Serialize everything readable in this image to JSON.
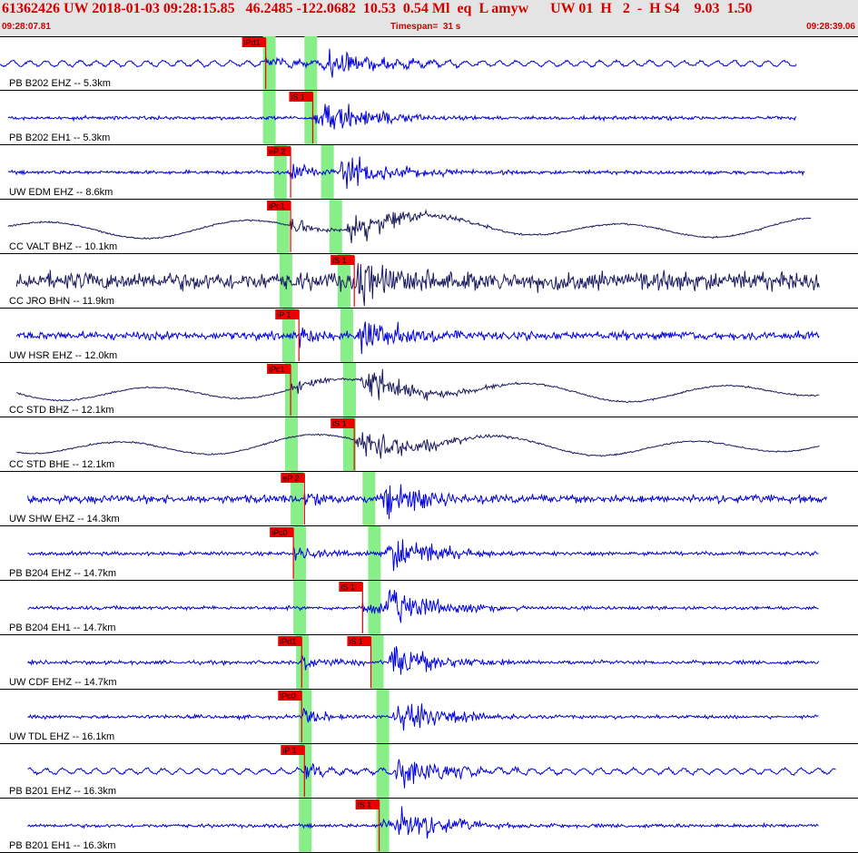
{
  "header": {
    "title": "61362426 UW 2018-01-03 09:28:15.85   46.2485 -122.0682  10.53  0.54 Ml  eq  L amyw      UW 01  H   2  -  H S4    9.03  1.50",
    "start_time": "09:28:07.81",
    "timespan": "Timespan=  31 s",
    "end_time": "09:28:39.06"
  },
  "colors": {
    "blue_trace": "#0000dd",
    "dark_trace": "#1a1a5e",
    "pick": "#ee0000",
    "window": "#88ee88",
    "header_text": "#d40000"
  },
  "chart_data": {
    "type": "seismogram",
    "x_range": [
      0,
      31
    ],
    "x_unit": "s",
    "traces": [
      {
        "label": "PB B202 EHZ -- 5.3km",
        "color": "blue",
        "trace_start": 0.0,
        "trace_end": 28.8,
        "picks": [
          {
            "text": "iPd1",
            "t": 9.6
          }
        ],
        "windows": [
          9.5,
          11.0
        ],
        "style": "microseism"
      },
      {
        "label": "PB B202 EH1 -- 5.3km",
        "color": "blue",
        "trace_start": 0.3,
        "trace_end": 28.8,
        "picks": [
          {
            "text": "iS 1",
            "t": 11.3
          }
        ],
        "windows": [
          9.5,
          11.0
        ],
        "style": "quiet"
      },
      {
        "label": "UW EDM EHZ -- 8.6km",
        "color": "blue",
        "trace_start": 0.3,
        "trace_end": 29.1,
        "picks": [
          {
            "text": "eP 2",
            "t": 10.5
          }
        ],
        "windows": [
          9.9,
          11.6
        ],
        "style": "quiet"
      },
      {
        "label": "CC VALT BHZ -- 10.1km",
        "color": "dark",
        "trace_start": 0.3,
        "trace_end": 29.3,
        "picks": [
          {
            "text": "iPc1",
            "t": 10.5
          }
        ],
        "windows": [
          10.0,
          11.9
        ],
        "style": "longperiod"
      },
      {
        "label": "CC JRO BHN -- 11.9km",
        "color": "dark",
        "trace_start": 0.6,
        "trace_end": 29.6,
        "picks": [
          {
            "text": "iS 1",
            "t": 12.8
          }
        ],
        "windows": [
          10.1,
          12.2
        ],
        "style": "noisy"
      },
      {
        "label": "UW HSR EHZ -- 12.0km",
        "color": "blue",
        "trace_start": 0.6,
        "trace_end": 29.6,
        "picks": [
          {
            "text": "iP 1",
            "t": 10.8
          }
        ],
        "windows": [
          10.2,
          12.3
        ],
        "style": "moderate"
      },
      {
        "label": "CC STD BHZ -- 12.1km",
        "color": "dark",
        "trace_start": 0.6,
        "trace_end": 29.6,
        "picks": [
          {
            "text": "iPc1",
            "t": 10.5
          }
        ],
        "windows": [
          10.3,
          12.4
        ],
        "style": "longperiod"
      },
      {
        "label": "CC STD BHE -- 12.1km",
        "color": "dark",
        "trace_start": 0.6,
        "trace_end": 29.6,
        "picks": [
          {
            "text": "iS 1",
            "t": 12.8
          }
        ],
        "windows": [
          10.3,
          12.4
        ],
        "style": "longperiod"
      },
      {
        "label": "UW SHW EHZ -- 14.3km",
        "color": "blue",
        "trace_start": 1.0,
        "trace_end": 29.9,
        "picks": [
          {
            "text": "eP 2",
            "t": 11.0
          }
        ],
        "windows": [
          10.5,
          13.1
        ],
        "style": "moderate"
      },
      {
        "label": "PB B204 EHZ -- 14.7km",
        "color": "blue",
        "trace_start": 1.0,
        "trace_end": 29.6,
        "picks": [
          {
            "text": "iPc0",
            "t": 10.6
          }
        ],
        "windows": [
          10.6,
          13.3
        ],
        "style": "quiet"
      },
      {
        "label": "PB B204 EH1 -- 14.7km",
        "color": "blue",
        "trace_start": 1.0,
        "trace_end": 29.6,
        "picks": [
          {
            "text": "iS 1",
            "t": 13.1
          }
        ],
        "windows": [
          10.6,
          13.3
        ],
        "style": "quiet"
      },
      {
        "label": "UW CDF EHZ -- 14.7km",
        "color": "blue",
        "trace_start": 1.0,
        "trace_end": 29.6,
        "picks": [
          {
            "text": "iPd1",
            "t": 10.9
          },
          {
            "text": "iS 1",
            "t": 13.4
          }
        ],
        "windows": [
          10.7,
          13.4
        ],
        "style": "quiet"
      },
      {
        "label": "UW TDL EHZ -- 16.1km",
        "color": "blue",
        "trace_start": 1.0,
        "trace_end": 29.6,
        "picks": [
          {
            "text": "iPc0",
            "t": 10.9
          }
        ],
        "windows": [
          10.8,
          13.6
        ],
        "style": "quiet"
      },
      {
        "label": "PB B201 EHZ -- 16.3km",
        "color": "blue",
        "trace_start": 1.0,
        "trace_end": 30.2,
        "picks": [
          {
            "text": "iP 1",
            "t": 11.0
          }
        ],
        "windows": [
          10.8,
          13.6
        ],
        "style": "microseism"
      },
      {
        "label": "PB B201 EH1 -- 16.3km",
        "color": "blue",
        "trace_start": 1.0,
        "trace_end": 29.6,
        "picks": [
          {
            "text": "iS 1",
            "t": 13.7
          }
        ],
        "windows": [
          10.8,
          13.6
        ],
        "style": "quiet"
      }
    ]
  }
}
